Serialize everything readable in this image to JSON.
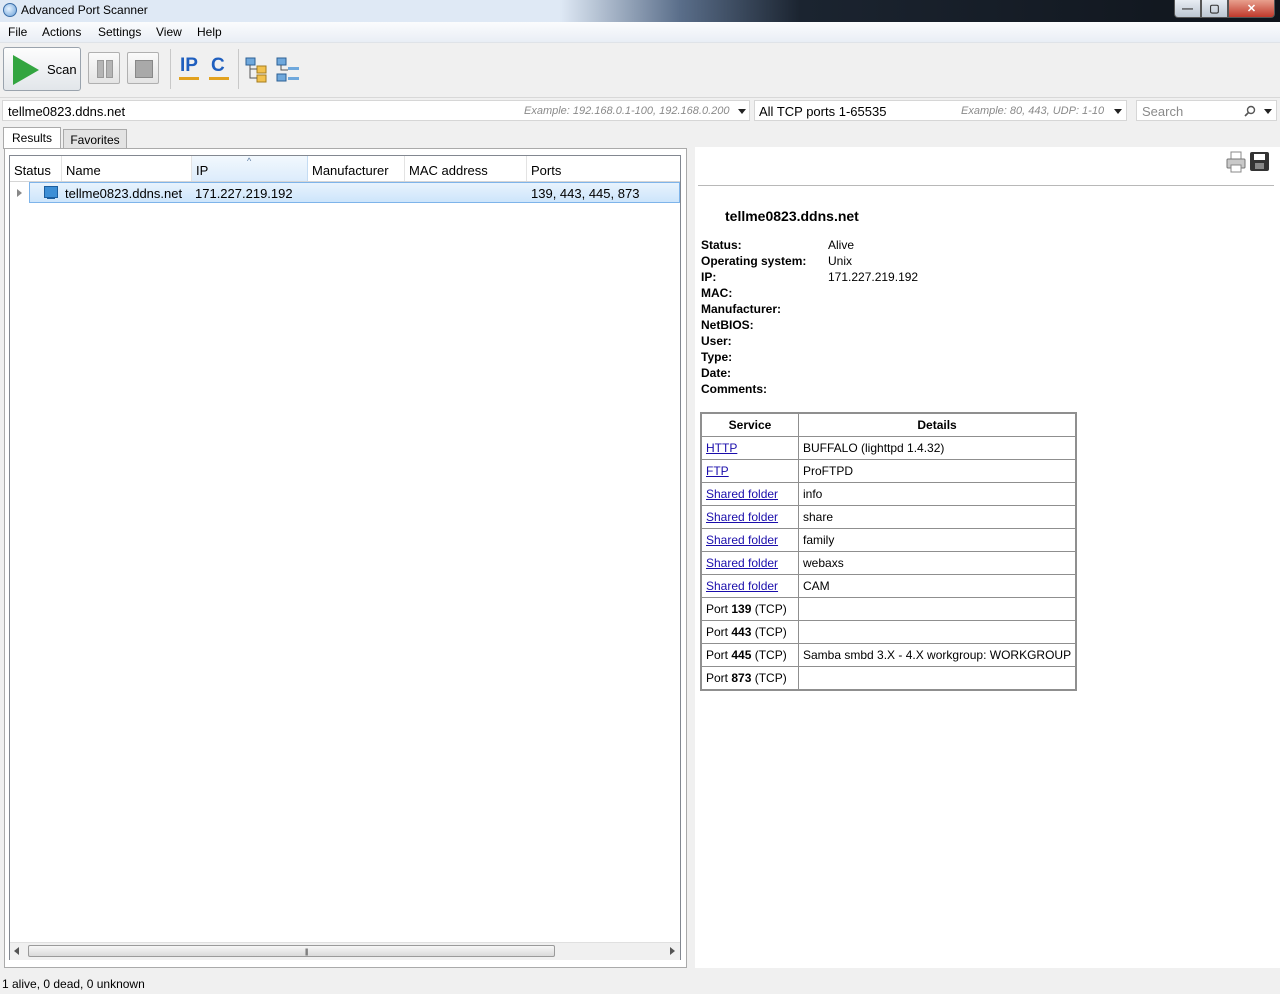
{
  "window": {
    "title": "Advanced Port Scanner",
    "min_glyph": "—",
    "max_glyph": "▢",
    "close_glyph": "✕"
  },
  "menu": [
    "File",
    "Actions",
    "Settings",
    "View",
    "Help"
  ],
  "toolbar": {
    "scan_label": "Scan",
    "ip_icon_text": "IP",
    "c_icon_text": "C"
  },
  "address_bar": {
    "target_value": "tellme0823.ddns.net",
    "target_hint": "Example: 192.168.0.1-100, 192.168.0.200",
    "ports_value": "All TCP ports 1-65535",
    "ports_hint": "Example: 80, 443, UDP: 1-10",
    "search_placeholder": "Search"
  },
  "tabs": [
    "Results",
    "Favorites"
  ],
  "grid": {
    "columns": [
      "Status",
      "Name",
      "IP",
      "Manufacturer",
      "MAC address",
      "Ports"
    ],
    "sorted_column": "IP",
    "rows": [
      {
        "name": "tellme0823.ddns.net",
        "ip": "171.227.219.192",
        "manufacturer": "",
        "mac": "",
        "ports": "139, 443, 445, 873"
      }
    ]
  },
  "details": {
    "title": "tellme0823.ddns.net",
    "properties": [
      {
        "label": "Status:",
        "value": "Alive"
      },
      {
        "label": "Operating system:",
        "value": "Unix"
      },
      {
        "label": "IP:",
        "value": "171.227.219.192"
      },
      {
        "label": "MAC:",
        "value": ""
      },
      {
        "label": "Manufacturer:",
        "value": ""
      },
      {
        "label": "NetBIOS:",
        "value": ""
      },
      {
        "label": "User:",
        "value": ""
      },
      {
        "label": "Type:",
        "value": ""
      },
      {
        "label": "Date:",
        "value": ""
      },
      {
        "label": "Comments:",
        "value": ""
      }
    ],
    "services_header": [
      "Service",
      "Details"
    ],
    "services": [
      {
        "service": "HTTP",
        "details": "BUFFALO (lighttpd 1.4.32)"
      },
      {
        "service": "FTP",
        "details": "ProFTPD"
      },
      {
        "service": "Shared folder",
        "details": "info"
      },
      {
        "service": "Shared folder",
        "details": "share"
      },
      {
        "service": "Shared folder",
        "details": "family"
      },
      {
        "service": "Shared folder",
        "details": "webaxs"
      },
      {
        "service": "Shared folder",
        "details": "CAM"
      }
    ],
    "ports": [
      {
        "prefix": "Port",
        "port": "139",
        "proto": "(TCP)",
        "details": ""
      },
      {
        "prefix": "Port",
        "port": "443",
        "proto": "(TCP)",
        "details": ""
      },
      {
        "prefix": "Port",
        "port": "445",
        "proto": "(TCP)",
        "details": "Samba smbd 3.X - 4.X workgroup: WORKGROUP"
      },
      {
        "prefix": "Port",
        "port": "873",
        "proto": "(TCP)",
        "details": ""
      }
    ]
  },
  "statusbar": {
    "text": "1 alive, 0 dead, 0 unknown"
  }
}
